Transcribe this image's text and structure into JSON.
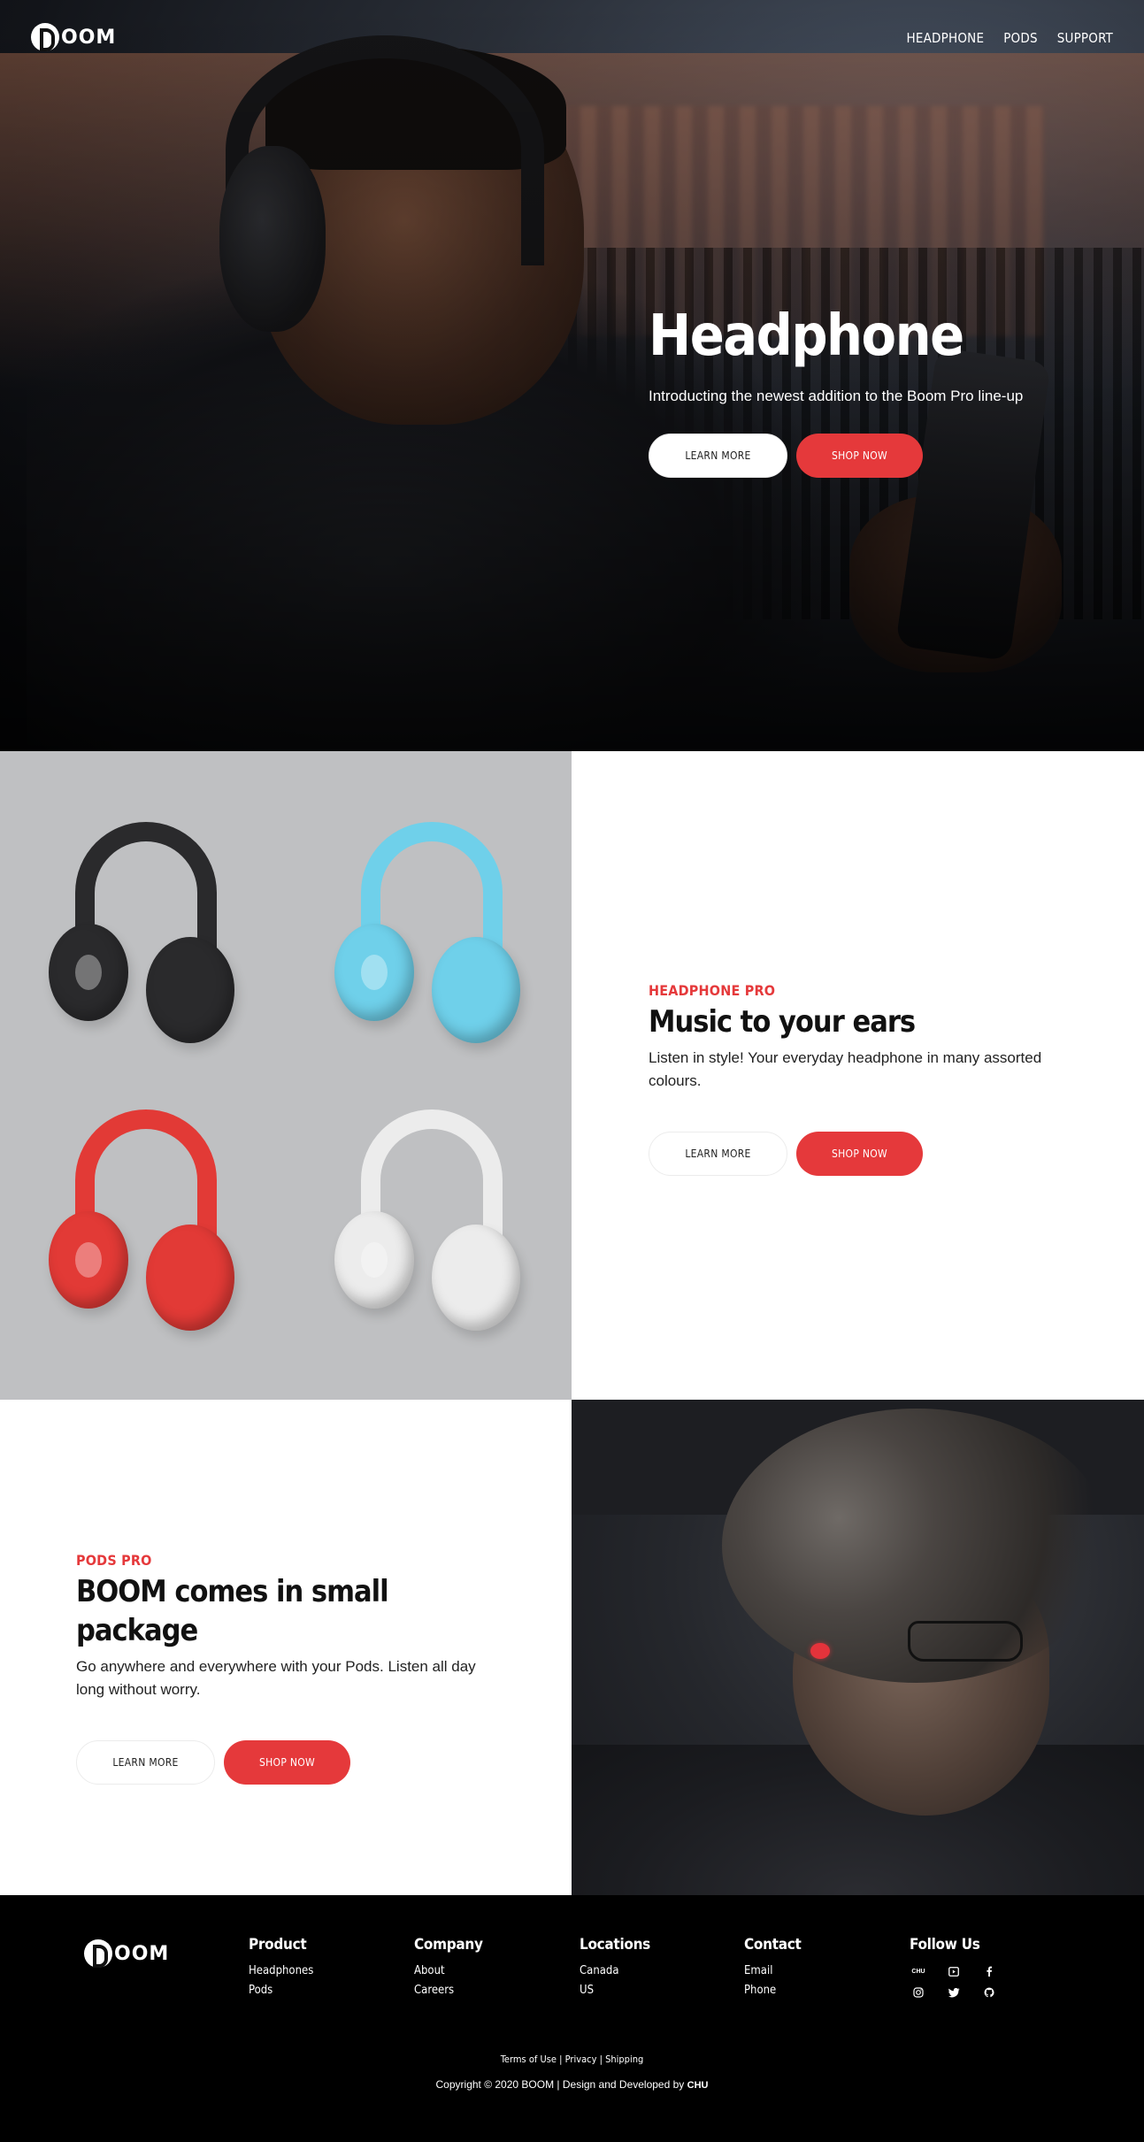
{
  "brand": {
    "logo_text": "OOM",
    "footer_logo_text": "OOM"
  },
  "nav": {
    "items": [
      "HEADPHONE",
      "PODS",
      "SUPPORT"
    ]
  },
  "hero": {
    "title": "Headphone",
    "subtitle": "Introducting the newest addition to the Boom Pro line-up",
    "learn_more": "LEARN MORE",
    "shop_now": "SHOP NOW"
  },
  "headphone_pro": {
    "eyebrow": "HEADPHONE PRO",
    "title": "Music to your ears",
    "description": "Listen in style! Your everyday headphone in many assorted colours.",
    "learn_more": "LEARN MORE",
    "shop_now": "SHOP NOW",
    "colors": [
      "#2a2a2c",
      "#6fd0ea",
      "#e23a36",
      "#ececec"
    ]
  },
  "pods_pro": {
    "eyebrow": "PODS PRO",
    "title": "BOOM comes in small package",
    "description": "Go anywhere and everywhere with your Pods. Listen all day long without worry.",
    "learn_more": "LEARN MORE",
    "shop_now": "SHOP NOW"
  },
  "footer": {
    "columns": [
      {
        "title": "Product",
        "links": [
          "Headphones",
          "Pods"
        ]
      },
      {
        "title": "Company",
        "links": [
          "About",
          "Careers"
        ]
      },
      {
        "title": "Locations",
        "links": [
          "Canada",
          "US"
        ]
      },
      {
        "title": "Contact",
        "links": [
          "Email",
          "Phone"
        ]
      }
    ],
    "follow_title": "Follow Us",
    "social_icons": [
      "chu-icon",
      "youtube-icon",
      "facebook-icon",
      "instagram-icon",
      "twitter-icon",
      "github-icon"
    ],
    "chu_label": "CHU",
    "legal": {
      "terms": "Terms of Use",
      "sep": " | ",
      "privacy": "Privacy",
      "shipping": "Shipping"
    },
    "copyright": "Copyright © 2020 BOOM | Design and Developed by",
    "dev_mark": "CHU"
  },
  "accent_color": "#e5393b"
}
